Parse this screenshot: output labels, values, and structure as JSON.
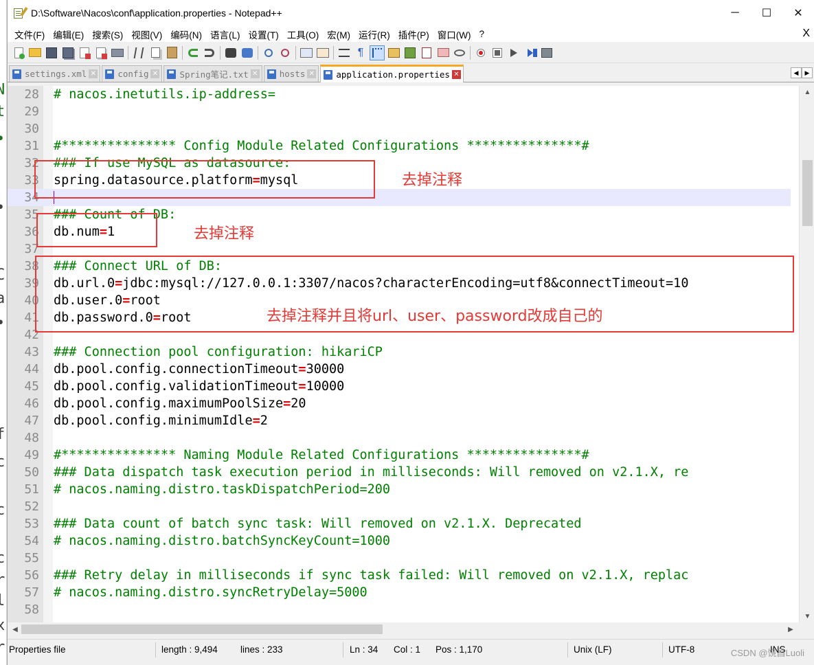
{
  "window": {
    "title": "D:\\Software\\Nacos\\conf\\application.properties - Notepad++",
    "minimize": "─",
    "maximize": "☐",
    "close": "✕"
  },
  "menu": [
    "文件(F)",
    "编辑(E)",
    "搜索(S)",
    "视图(V)",
    "编码(N)",
    "语言(L)",
    "设置(T)",
    "工具(O)",
    "宏(M)",
    "运行(R)",
    "插件(P)",
    "窗口(W)",
    "?"
  ],
  "menu_close": "X",
  "tabs": [
    {
      "label": "settings.xml",
      "active": false
    },
    {
      "label": "config",
      "active": false
    },
    {
      "label": "Spring笔记.txt",
      "active": false
    },
    {
      "label": "hosts",
      "active": false
    },
    {
      "label": "application.properties",
      "active": true
    }
  ],
  "tab_close_glyph": "✕",
  "tab_scroll_left": "◀",
  "tab_scroll_right": "▶",
  "editor": {
    "current_line": 34,
    "lines": [
      {
        "n": "28",
        "t": "# nacos.inetutils.ip-address=",
        "k": "c"
      },
      {
        "n": "29",
        "t": "",
        "k": "c"
      },
      {
        "n": "30",
        "t": "",
        "k": "c"
      },
      {
        "n": "31",
        "t": "#*************** Config Module Related Configurations ***************#",
        "k": "c"
      },
      {
        "n": "32",
        "t": "### If use MySQL as datasource:",
        "k": "c"
      },
      {
        "n": "33",
        "key": "spring.datasource.platform",
        "val": "mysql",
        "k": "kv"
      },
      {
        "n": "34",
        "t": "",
        "k": "c"
      },
      {
        "n": "35",
        "t": "### Count of DB:",
        "k": "c"
      },
      {
        "n": "36",
        "key": "db.num",
        "val": "1",
        "k": "kv"
      },
      {
        "n": "37",
        "t": "",
        "k": "c"
      },
      {
        "n": "38",
        "t": "### Connect URL of DB:",
        "k": "c"
      },
      {
        "n": "39",
        "key": "db.url.0",
        "val": "jdbc:mysql://127.0.0.1:3307/nacos?characterEncoding=utf8&connectTimeout=10",
        "k": "kv"
      },
      {
        "n": "40",
        "key": "db.user.0",
        "val": "root",
        "k": "kv"
      },
      {
        "n": "41",
        "key": "db.password.0",
        "val": "root",
        "k": "kv"
      },
      {
        "n": "42",
        "t": "",
        "k": "c"
      },
      {
        "n": "43",
        "t": "### Connection pool configuration: hikariCP",
        "k": "c"
      },
      {
        "n": "44",
        "key": "db.pool.config.connectionTimeout",
        "val": "30000",
        "k": "kv"
      },
      {
        "n": "45",
        "key": "db.pool.config.validationTimeout",
        "val": "10000",
        "k": "kv"
      },
      {
        "n": "46",
        "key": "db.pool.config.maximumPoolSize",
        "val": "20",
        "k": "kv"
      },
      {
        "n": "47",
        "key": "db.pool.config.minimumIdle",
        "val": "2",
        "k": "kv"
      },
      {
        "n": "48",
        "t": "",
        "k": "c"
      },
      {
        "n": "49",
        "t": "#*************** Naming Module Related Configurations ***************#",
        "k": "c"
      },
      {
        "n": "50",
        "t": "### Data dispatch task execution period in milliseconds: Will removed on v2.1.X, re",
        "k": "c"
      },
      {
        "n": "51",
        "t": "# nacos.naming.distro.taskDispatchPeriod=200",
        "k": "c"
      },
      {
        "n": "52",
        "t": "",
        "k": "c"
      },
      {
        "n": "53",
        "t": "### Data count of batch sync task: Will removed on v2.1.X. Deprecated",
        "k": "c"
      },
      {
        "n": "54",
        "t": "# nacos.naming.distro.batchSyncKeyCount=1000",
        "k": "c"
      },
      {
        "n": "55",
        "t": "",
        "k": "c"
      },
      {
        "n": "56",
        "t": "### Retry delay in milliseconds if sync task failed: Will removed on v2.1.X, replac",
        "k": "c"
      },
      {
        "n": "57",
        "t": "# nacos.naming.distro.syncRetryDelay=5000",
        "k": "c"
      },
      {
        "n": "58",
        "t": "",
        "k": "c"
      }
    ]
  },
  "annotations": {
    "note1": "去掉注释",
    "note2": "去掉注释",
    "note3": "去掉注释并且将url、user、password改成自己的"
  },
  "status": {
    "file_type": "Properties file",
    "length": "length : 9,494",
    "lines": "lines : 233",
    "ln": "Ln : 34",
    "col": "Col : 1",
    "pos": "Pos : 1,170",
    "eol": "Unix (LF)",
    "encoding": "UTF-8",
    "mode": "INS"
  },
  "watermark": "CSDN @饶昌Luoli",
  "bg_chars": [
    "Ν",
    "t",
    "•",
    "•",
    "C",
    "a",
    "•",
    "f",
    "c",
    "c",
    "c",
    "r",
    "l",
    "x",
    "r"
  ],
  "colors": {
    "comment": "#008000",
    "operator": "#e00000",
    "annotation": "#e53935",
    "active_tab_accent": "#f5a623",
    "current_line_bg": "#e8e8ff"
  }
}
